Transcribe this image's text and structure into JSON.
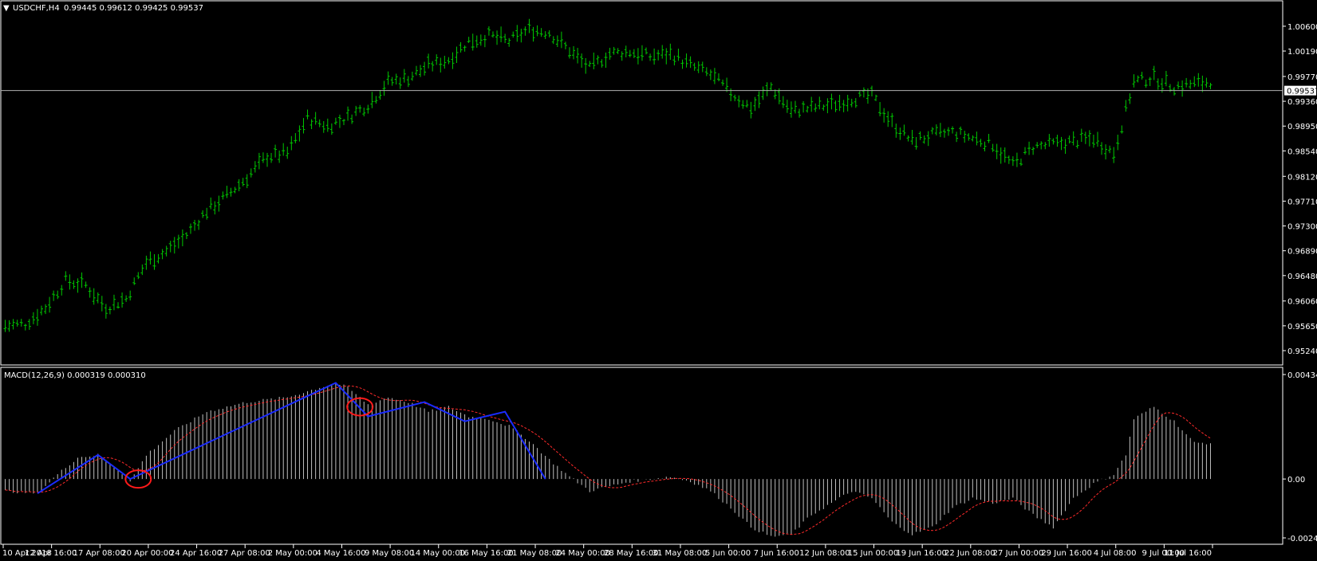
{
  "chart_data": [
    {
      "type": "candlestick",
      "header": {
        "symbol_label": "USDCHF,H4",
        "ohlc_text": "0.99445 0.99612 0.99425 0.99537",
        "current_price_label": "0.99537"
      },
      "current_price": 0.99537,
      "ylim": [
        0.9524,
        1.0077
      ],
      "y_ticks": [
        1.006,
        1.0019,
        0.9977,
        0.9936,
        0.9895,
        0.9854,
        0.9812,
        0.9771,
        0.973,
        0.9689,
        0.9648,
        0.9606,
        0.9565,
        0.9524
      ],
      "y_tick_labels": [
        "1.00600",
        "1.00190",
        "0.99770",
        "0.99360",
        "0.98950",
        "0.98540",
        "0.98120",
        "0.97710",
        "0.97300",
        "0.96890",
        "0.96480",
        "0.96060",
        "0.95650",
        "0.95240"
      ],
      "price_path": {
        "bar_count": 300,
        "anchors": [
          [
            0,
            0.9565
          ],
          [
            5,
            0.9568
          ],
          [
            10,
            0.9595
          ],
          [
            15,
            0.964
          ],
          [
            20,
            0.9632
          ],
          [
            25,
            0.9595
          ],
          [
            30,
            0.961
          ],
          [
            35,
            0.967
          ],
          [
            40,
            0.9688
          ],
          [
            45,
            0.9715
          ],
          [
            50,
            0.9755
          ],
          [
            55,
            0.978
          ],
          [
            60,
            0.981
          ],
          [
            65,
            0.9845
          ],
          [
            70,
            0.985
          ],
          [
            75,
            0.9908
          ],
          [
            80,
            0.9895
          ],
          [
            85,
            0.991
          ],
          [
            90,
            0.993
          ],
          [
            95,
            0.9968
          ],
          [
            100,
            0.9975
          ],
          [
            105,
            0.9995
          ],
          [
            110,
            1.0005
          ],
          [
            115,
            1.0035
          ],
          [
            120,
            1.0045
          ],
          [
            125,
            1.0035
          ],
          [
            130,
            1.0055
          ],
          [
            135,
            1.005
          ],
          [
            140,
            1.002
          ],
          [
            145,
            0.999
          ],
          [
            150,
            1.0015
          ],
          [
            155,
            1.0018
          ],
          [
            160,
            1.001
          ],
          [
            165,
            1.0015
          ],
          [
            170,
            0.9995
          ],
          [
            175,
            0.998
          ],
          [
            180,
            0.995
          ],
          [
            185,
            0.9925
          ],
          [
            190,
            0.996
          ],
          [
            195,
            0.992
          ],
          [
            200,
            0.9925
          ],
          [
            205,
            0.993
          ],
          [
            210,
            0.994
          ],
          [
            215,
            0.9945
          ],
          [
            220,
            0.99
          ],
          [
            225,
            0.987
          ],
          [
            230,
            0.988
          ],
          [
            235,
            0.9885
          ],
          [
            240,
            0.9875
          ],
          [
            245,
            0.9865
          ],
          [
            250,
            0.983
          ],
          [
            255,
            0.986
          ],
          [
            260,
            0.9865
          ],
          [
            265,
            0.987
          ],
          [
            270,
            0.9875
          ],
          [
            275,
            0.985
          ],
          [
            280,
            0.9968
          ],
          [
            285,
            0.9975
          ],
          [
            290,
            0.996
          ],
          [
            295,
            0.9965
          ],
          [
            300,
            0.997
          ]
        ]
      },
      "x_tick_labels": [
        "10 Apr 2018",
        "12 Apr 16:00",
        "17 Apr 08:00",
        "20 Apr 00:00",
        "24 Apr 16:00",
        "27 Apr 08:00",
        "2 May 00:00",
        "4 May 16:00",
        "9 May 08:00",
        "14 May 00:00",
        "16 May 16:00",
        "21 May 08:00",
        "24 May 00:00",
        "28 May 16:00",
        "31 May 08:00",
        "5 Jun 00:00",
        "7 Jun 16:00",
        "12 Jun 08:00",
        "15 Jun 00:00",
        "19 Jun 16:00",
        "22 Jun 08:00",
        "27 Jun 00:00",
        "29 Jun 16:00",
        "4 Jul 08:00",
        "9 Jul 00:00",
        "11 Jul 16:00"
      ]
    },
    {
      "type": "histogram",
      "header": {
        "label": "MACD(12,26,9) 0.000319 0.000310"
      },
      "ylim": [
        -0.002448,
        0.004344
      ],
      "y_ticks": [
        0.004344,
        0.0,
        -0.002448
      ],
      "y_tick_labels": [
        "0.004344",
        "0.00",
        "-0.002448"
      ],
      "macd_path": {
        "bar_count": 300,
        "anchors": [
          [
            0,
            -0.0005
          ],
          [
            8,
            -0.0006
          ],
          [
            13,
            0.0002
          ],
          [
            18,
            0.0009
          ],
          [
            23,
            0.001
          ],
          [
            28,
            0.0004
          ],
          [
            31,
            -0.0001
          ],
          [
            35,
            0.001
          ],
          [
            42,
            0.002
          ],
          [
            50,
            0.0028
          ],
          [
            60,
            0.0032
          ],
          [
            70,
            0.0034
          ],
          [
            78,
            0.0038
          ],
          [
            82,
            0.004
          ],
          [
            85,
            0.0038
          ],
          [
            90,
            0.0031
          ],
          [
            95,
            0.0034
          ],
          [
            100,
            0.0032
          ],
          [
            105,
            0.0028
          ],
          [
            110,
            0.003
          ],
          [
            115,
            0.0026
          ],
          [
            120,
            0.0025
          ],
          [
            125,
            0.0022
          ],
          [
            130,
            0.0016
          ],
          [
            135,
            0.0008
          ],
          [
            140,
            0.0001
          ],
          [
            145,
            -0.0005
          ],
          [
            150,
            -0.0003
          ],
          [
            155,
            -0.0001
          ],
          [
            160,
            0.0
          ],
          [
            165,
            0.0001
          ],
          [
            170,
            -0.0001
          ],
          [
            175,
            -0.0005
          ],
          [
            180,
            -0.0012
          ],
          [
            185,
            -0.002
          ],
          [
            190,
            -0.0024
          ],
          [
            195,
            -0.0023
          ],
          [
            200,
            -0.0015
          ],
          [
            205,
            -0.001
          ],
          [
            210,
            -0.0005
          ],
          [
            215,
            -0.0008
          ],
          [
            220,
            -0.0018
          ],
          [
            225,
            -0.0023
          ],
          [
            230,
            -0.002
          ],
          [
            235,
            -0.0012
          ],
          [
            240,
            -0.0008
          ],
          [
            245,
            -0.001
          ],
          [
            250,
            -0.0008
          ],
          [
            255,
            -0.0015
          ],
          [
            260,
            -0.002
          ],
          [
            265,
            -0.0008
          ],
          [
            270,
            -0.0002
          ],
          [
            275,
            0.0002
          ],
          [
            278,
            0.001
          ],
          [
            280,
            0.0025
          ],
          [
            285,
            0.003
          ],
          [
            290,
            0.0024
          ],
          [
            295,
            0.0015
          ]
        ]
      },
      "signal_color": "#ff2a2a",
      "histogram_color": "#c0c0c0"
    }
  ],
  "colors": {
    "background": "#000000",
    "bar_color": "#00c800",
    "grid_frame": "#ffffff",
    "annotation_line": "#1a2bff",
    "annotation_circle": "#ff1a1a"
  },
  "annotations": {
    "blue_trendline_bars": [
      [
        8,
        -0.0006
      ],
      [
        23,
        0.001
      ],
      [
        31,
        0.0
      ],
      [
        82,
        0.004
      ],
      [
        90,
        0.0026
      ],
      [
        104,
        0.0032
      ],
      [
        114,
        0.0024
      ],
      [
        124,
        0.0028
      ],
      [
        134,
        0.0
      ]
    ],
    "red_circles_bars": [
      [
        33,
        0.0
      ],
      [
        88,
        0.003
      ]
    ]
  }
}
